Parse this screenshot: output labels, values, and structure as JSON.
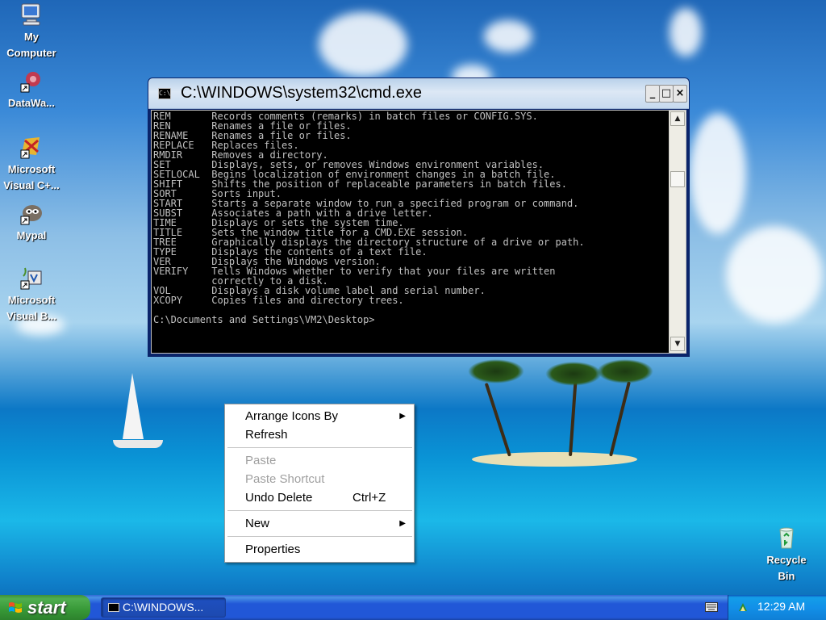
{
  "desktop": {
    "icons": [
      {
        "label": "My\nComputer",
        "icon": "my-computer-icon"
      },
      {
        "label": "DataWa...",
        "icon": "datawa-icon"
      },
      {
        "label": "Microsoft\nVisual C+...",
        "icon": "visual-cpp-icon"
      },
      {
        "label": "Mypal",
        "icon": "mypal-icon"
      },
      {
        "label": "Microsoft\nVisual B...",
        "icon": "visual-basic-icon"
      },
      {
        "label": "Recycle\nBin",
        "icon": "recycle-bin-icon"
      }
    ]
  },
  "cmd_window": {
    "title": "C:\\WINDOWS\\system32\\cmd.exe",
    "minimize": "_",
    "maximize": "□",
    "close": "×",
    "scroll_up": "▲",
    "scroll_down": "▼",
    "text": "REM       Records comments (remarks) in batch files or CONFIG.SYS.\nREN       Renames a file or files.\nRENAME    Renames a file or files.\nREPLACE   Replaces files.\nRMDIR     Removes a directory.\nSET       Displays, sets, or removes Windows environment variables.\nSETLOCAL  Begins localization of environment changes in a batch file.\nSHIFT     Shifts the position of replaceable parameters in batch files.\nSORT      Sorts input.\nSTART     Starts a separate window to run a specified program or command.\nSUBST     Associates a path with a drive letter.\nTIME      Displays or sets the system time.\nTITLE     Sets the window title for a CMD.EXE session.\nTREE      Graphically displays the directory structure of a drive or path.\nTYPE      Displays the contents of a text file.\nVER       Displays the Windows version.\nVERIFY    Tells Windows whether to verify that your files are written\n          correctly to a disk.\nVOL       Displays a disk volume label and serial number.\nXCOPY     Copies files and directory trees.\n\nC:\\Documents and Settings\\VM2\\Desktop>"
  },
  "context_menu": {
    "arrange_icons_by": "Arrange Icons By",
    "refresh": "Refresh",
    "paste": "Paste",
    "paste_shortcut": "Paste Shortcut",
    "undo_delete": "Undo Delete",
    "undo_delete_accel": "Ctrl+Z",
    "new": "New",
    "properties": "Properties",
    "submenu_arrow": "▶"
  },
  "taskbar": {
    "start_label": "start",
    "task_label": "C:\\WINDOWS...",
    "clock": "12:29 AM"
  }
}
